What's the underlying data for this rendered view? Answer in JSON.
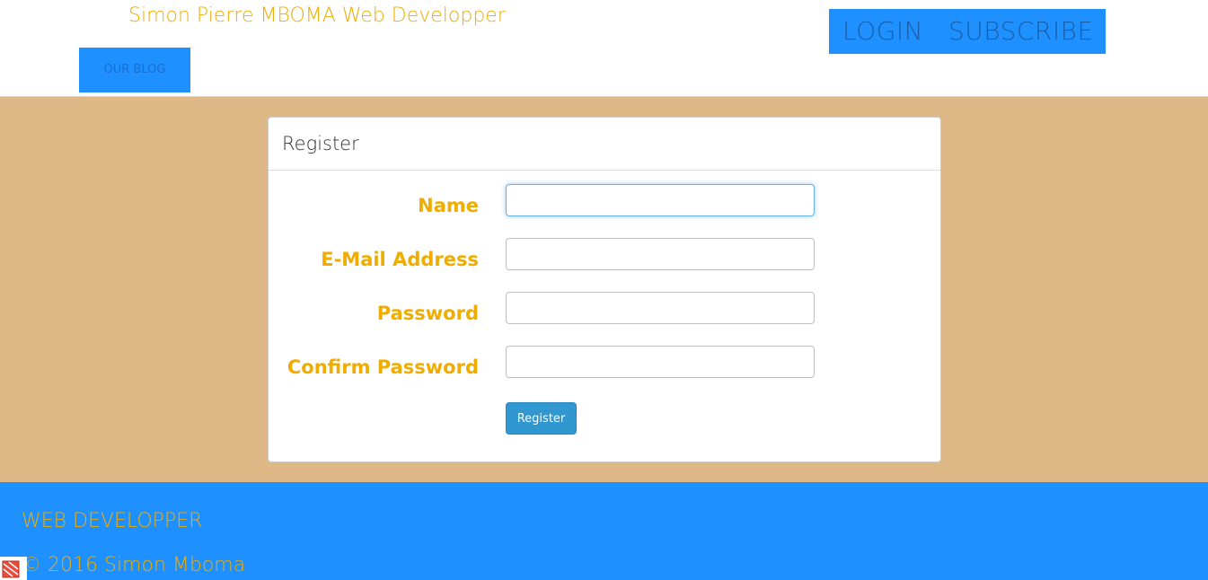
{
  "header": {
    "brand": "Simon Pierre MBOMA Web Developper",
    "login_label": "LOGIN",
    "subscribe_label": "SUBSCRIBE",
    "blog_label": "OUR BLOG"
  },
  "panel": {
    "title": "Register",
    "fields": [
      {
        "label": "Name",
        "value": ""
      },
      {
        "label": "E-Mail Address",
        "value": ""
      },
      {
        "label": "Password",
        "value": ""
      },
      {
        "label": "Confirm Password",
        "value": ""
      }
    ],
    "submit_label": "Register"
  },
  "footer": {
    "title": "WEB DEVELOPPER",
    "copyright": "© 2016 Simon Mboma"
  },
  "colors": {
    "accent": "#f0ad00",
    "nav_blue": "#1e90ff",
    "background_tan": "#deb887",
    "button_blue": "#3097d1"
  }
}
